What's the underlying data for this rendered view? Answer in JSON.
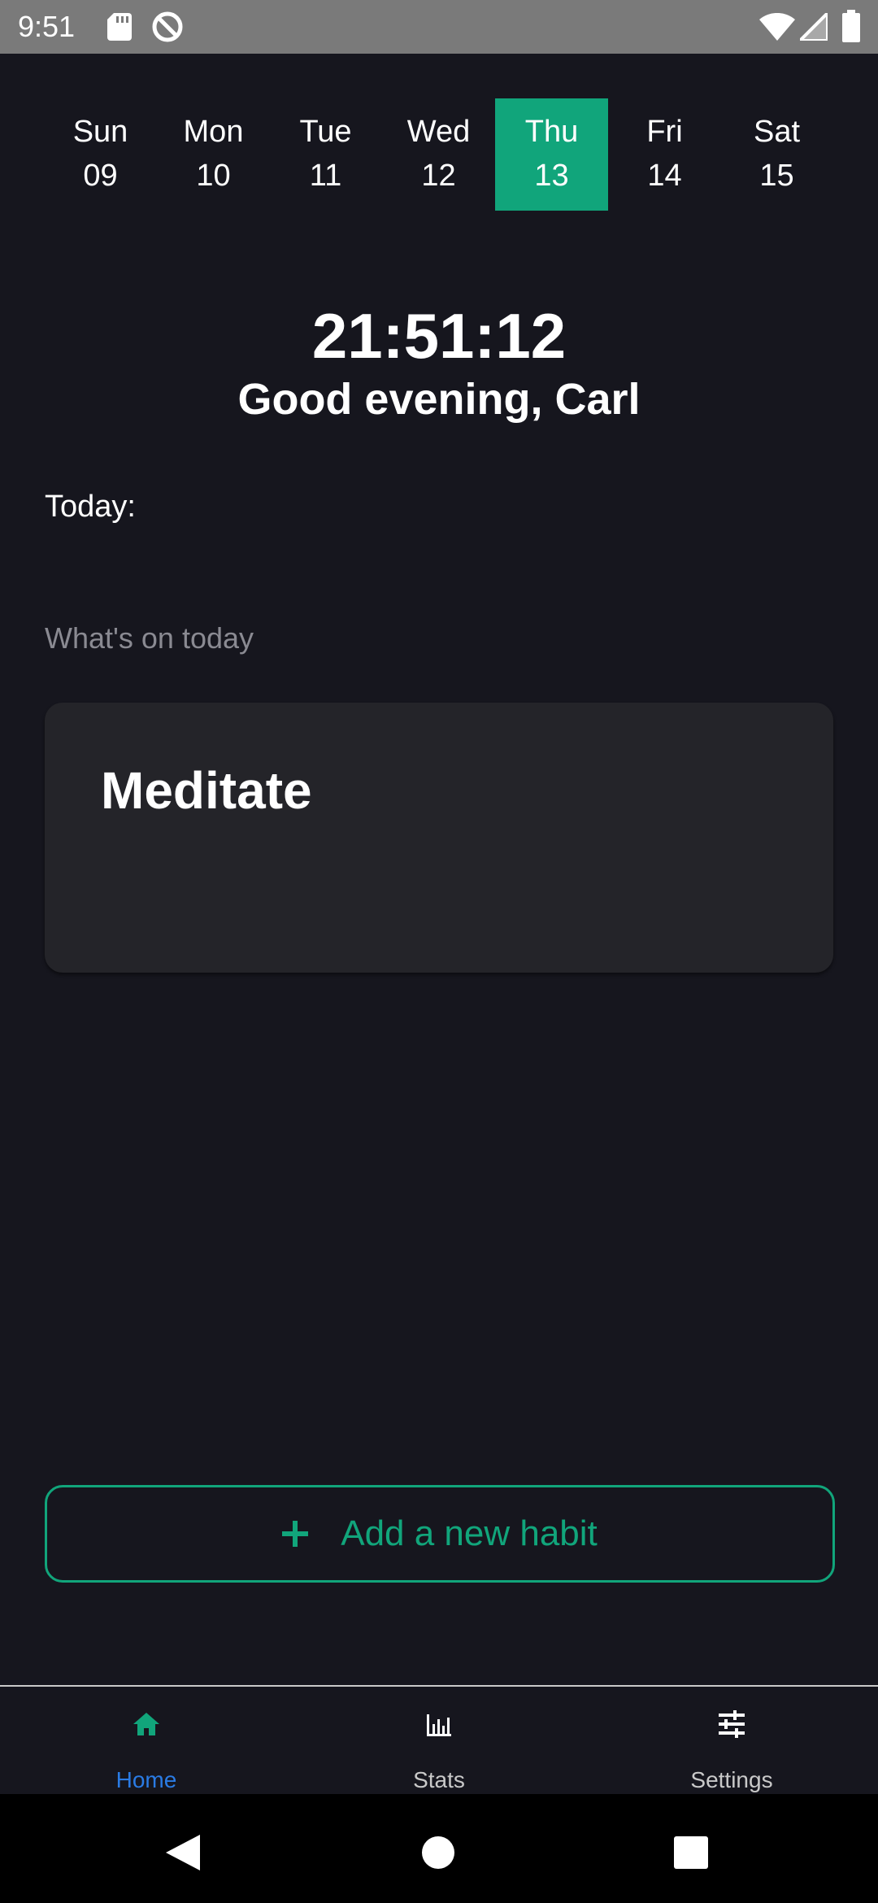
{
  "status_bar": {
    "time": "9:51",
    "icons": [
      "sd-card-icon",
      "do-not-disturb-icon",
      "wifi-icon",
      "signal-icon",
      "battery-icon"
    ]
  },
  "week": {
    "days": [
      {
        "name": "Sun",
        "date": "09",
        "selected": false
      },
      {
        "name": "Mon",
        "date": "10",
        "selected": false
      },
      {
        "name": "Tue",
        "date": "11",
        "selected": false
      },
      {
        "name": "Wed",
        "date": "12",
        "selected": false
      },
      {
        "name": "Thu",
        "date": "13",
        "selected": true
      },
      {
        "name": "Fri",
        "date": "14",
        "selected": false
      },
      {
        "name": "Sat",
        "date": "15",
        "selected": false
      }
    ]
  },
  "header": {
    "clock": "21:51:12",
    "greeting": "Good evening, Carl"
  },
  "today_label": "Today:",
  "section_label": "What's on today",
  "habits": [
    {
      "title": "Meditate"
    }
  ],
  "add_button": {
    "label": "Add a new habit",
    "icon": "plus-icon"
  },
  "bottom_nav": {
    "items": [
      {
        "label": "Home",
        "icon": "home-icon",
        "active": true
      },
      {
        "label": "Stats",
        "icon": "bar-chart-icon",
        "active": false
      },
      {
        "label": "Settings",
        "icon": "sliders-icon",
        "active": false
      }
    ]
  },
  "system_nav": {
    "buttons": [
      "back-icon",
      "home-circle-icon",
      "recents-square-icon"
    ]
  },
  "colors": {
    "background": "#16161e",
    "accent": "#11a57b",
    "card": "#242429",
    "nav_active": "#2a7be4",
    "nav_inactive": "#c9c9c9",
    "muted_text": "#8a8a92",
    "status_bar": "#7a7a7a"
  }
}
